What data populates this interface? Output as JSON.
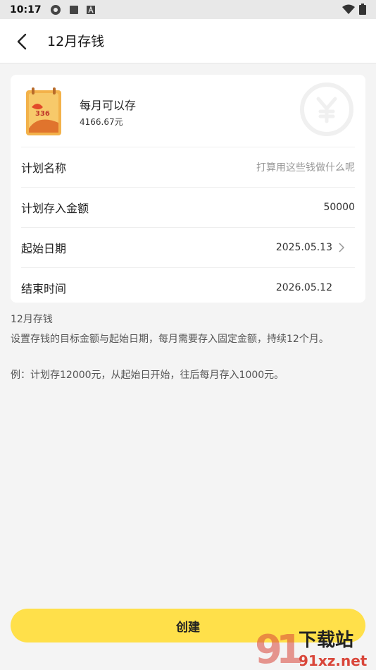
{
  "status_bar": {
    "time": "10:17"
  },
  "header": {
    "title": "12月存钱"
  },
  "card": {
    "monthly_label": "每月可以存",
    "monthly_value": "4166.67元",
    "calendar_number": "336",
    "rows": [
      {
        "label": "计划名称",
        "value": "打算用这些钱做什么呢"
      },
      {
        "label": "计划存入金额",
        "value": "50000"
      },
      {
        "label": "起始日期",
        "value": "2025.05.13"
      },
      {
        "label": "结束时间",
        "value": "2026.05.12"
      }
    ]
  },
  "description": {
    "title": "12月存钱",
    "line1": "设置存钱的目标金额与起始日期，每月需要存入固定金额，持续12个月。",
    "example": "例：计划存12000元，从起始日开始，往后每月存入1000元。"
  },
  "actions": {
    "create_label": "创建"
  },
  "watermark": {
    "top": "下载站",
    "bottom": "91xz.net"
  }
}
